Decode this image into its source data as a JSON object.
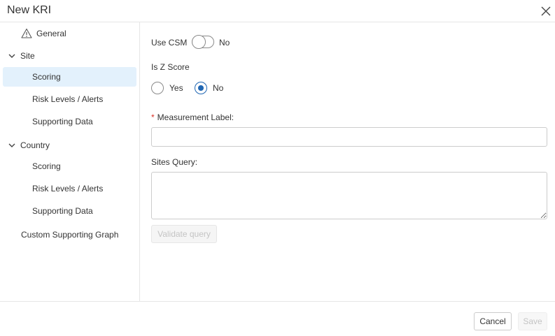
{
  "dialog": {
    "title": "New KRI"
  },
  "sidebar": {
    "general": "General",
    "site": {
      "label": "Site",
      "items": [
        "Scoring",
        "Risk Levels / Alerts",
        "Supporting Data"
      ],
      "selected_index": 0
    },
    "country": {
      "label": "Country",
      "items": [
        "Scoring",
        "Risk Levels / Alerts",
        "Supporting Data"
      ]
    },
    "custom": "Custom Supporting Graph"
  },
  "form": {
    "use_csm": {
      "label": "Use CSM",
      "state_label": "No",
      "value": false
    },
    "is_z_score": {
      "label": "Is Z Score",
      "options": [
        "Yes",
        "No"
      ],
      "selected": "No"
    },
    "measurement_label": {
      "label": "Measurement Label:",
      "required_marker": "*",
      "value": "",
      "placeholder": ""
    },
    "sites_query": {
      "label": "Sites Query:",
      "value": "",
      "placeholder": ""
    },
    "validate_button": "Validate query"
  },
  "footer": {
    "cancel": "Cancel",
    "save": "Save"
  },
  "colors": {
    "accent": "#1f66b3",
    "selected_bg": "#e3f1fc",
    "required": "#d93025",
    "border": "#e6e6e6"
  }
}
